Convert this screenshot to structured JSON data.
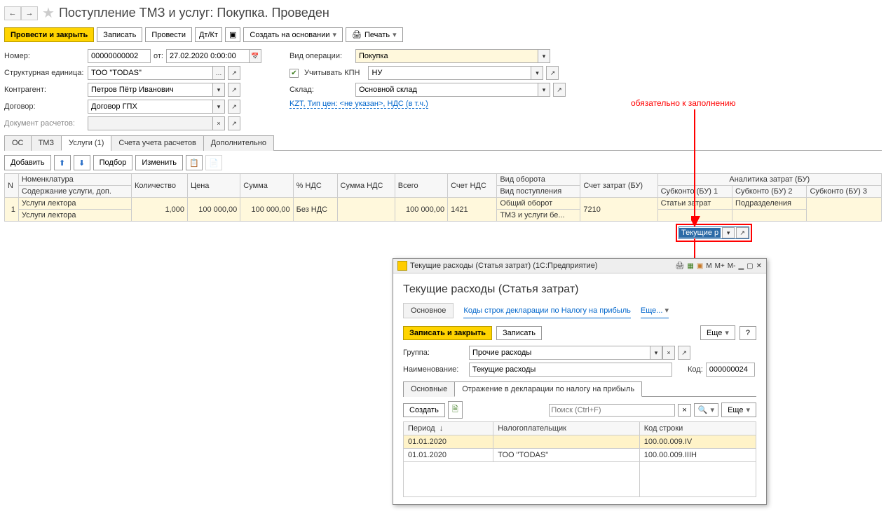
{
  "header": {
    "title": "Поступление ТМЗ и услуг: Покупка. Проведен"
  },
  "toolbar": {
    "post_close": "Провести и закрыть",
    "write": "Записать",
    "post": "Провести",
    "create_based": "Создать на основании",
    "print": "Печать"
  },
  "form": {
    "number_lbl": "Номер:",
    "number": "00000000002",
    "ot": "от:",
    "date": "27.02.2020 0:00:00",
    "unit_lbl": "Структурная единица:",
    "unit": "ТОО \"TODAS\"",
    "contragent_lbl": "Контрагент:",
    "contragent": "Петров Пётр Иванович",
    "contract_lbl": "Договор:",
    "contract": "Договор ГПХ",
    "docpay_lbl": "Документ расчетов:",
    "docpay": "",
    "optype_lbl": "Вид операции:",
    "optype": "Покупка",
    "kpn_lbl": "Учитывать КПН",
    "kpn_val": "НУ",
    "sklad_lbl": "Склад:",
    "sklad": "Основной склад",
    "price_info": "KZT, Тип цен: <не указан>, НДС (в т.ч.)"
  },
  "tabs": {
    "t1": "ОС",
    "t2": "ТМЗ",
    "t3": "Услуги (1)",
    "t4": "Счета учета расчетов",
    "t5": "Дополнительно"
  },
  "sub": {
    "add": "Добавить",
    "podbor": "Подбор",
    "change": "Изменить"
  },
  "grid": {
    "h_n": "N",
    "h_nom": "Номенклатура",
    "h_content": "Содержание услуги, доп.",
    "h_qty": "Количество",
    "h_price": "Цена",
    "h_sum": "Сумма",
    "h_pnds": "% НДС",
    "h_sumnds": "Сумма НДС",
    "h_total": "Всего",
    "h_accnds": "Счет НДС",
    "h_oborot": "Вид оборота",
    "h_postup": "Вид поступления",
    "h_cost": "Счет затрат (БУ)",
    "h_anal": "Аналитика затрат (БУ)",
    "h_s1": "Субконто (БУ) 1",
    "h_s2": "Субконто (БУ) 2",
    "h_s3": "Субконто (БУ) 3",
    "row": {
      "n": "1",
      "nom": "Услуги лектора",
      "cont": "Услуги лектора",
      "qty": "1,000",
      "price": "100 000,00",
      "sum": "100 000,00",
      "pnds": "Без НДС",
      "sumnds": "",
      "total": "100 000,00",
      "accnds": "1421",
      "oborot": "Общий оборот",
      "postup": "ТМЗ и услуги бе...",
      "cost": "7210",
      "s1a": "Статьи затрат",
      "s1b": "Текущие р",
      "s2": "Подразделения"
    }
  },
  "note": "обязательно к заполнению",
  "popup": {
    "title": "Текущие расходы (Статья затрат)  (1С:Предприятие)",
    "h1": "Текущие расходы (Статья затрат)",
    "pt1": "Основное",
    "pt2": "Коды строк декларации по Налогу на прибыль",
    "pt3": "Еще...",
    "save_close": "Записать и закрыть",
    "write": "Записать",
    "more": "Еще",
    "group_lbl": "Группа:",
    "group": "Прочие расходы",
    "name_lbl": "Наименование:",
    "name": "Текущие расходы",
    "code_lbl": "Код:",
    "code": "000000024",
    "it1": "Основные",
    "it2": "Отражение в декларации по налогу на прибыль",
    "create": "Создать",
    "search_ph": "Поиск (Ctrl+F)",
    "th_period": "Период",
    "th_payer": "Налогоплательщик",
    "th_code": "Код строки",
    "rows": [
      {
        "period": "01.01.2020",
        "payer": "",
        "code": "100.00.009.IV"
      },
      {
        "period": "01.01.2020",
        "payer": "ТОО \"TODAS\"",
        "code": "100.00.009.IIIH"
      }
    ]
  }
}
